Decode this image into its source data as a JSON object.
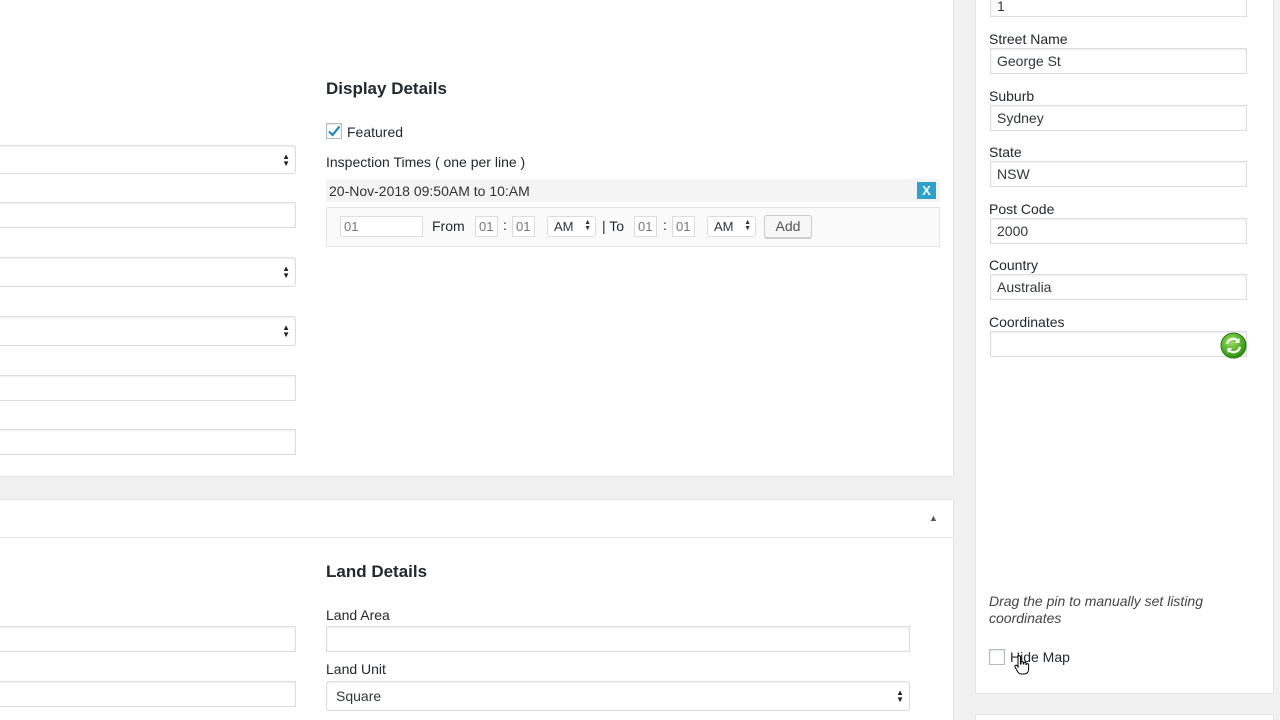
{
  "display_details": {
    "heading": "Display Details",
    "featured_label": "Featured",
    "featured_checked": true,
    "inspection_label": "Inspection Times ( one per line )",
    "inspection_entries": [
      "20-Nov-2018 09:50AM to 10:AM"
    ],
    "remove_label": "X",
    "new_entry": {
      "date_placeholder": "01",
      "from_label": "From",
      "from_hour": "01",
      "from_min": "01",
      "separator": ":",
      "from_ampm": "AM",
      "to_label": "| To",
      "to_hour": "01",
      "to_min": "01",
      "to_ampm": "AM",
      "add_label": "Add"
    }
  },
  "land_details": {
    "heading": "Land Details",
    "land_area_label": "Land Area",
    "land_area_value": "",
    "land_unit_label": "Land Unit",
    "land_unit_value": "Square"
  },
  "address": {
    "street_number_value": "1",
    "street_name_label": "Street Name",
    "street_name_value": "George St",
    "suburb_label": "Suburb",
    "suburb_value": "Sydney",
    "state_label": "State",
    "state_value": "NSW",
    "postcode_label": "Post Code",
    "postcode_value": "2000",
    "country_label": "Country",
    "country_value": "Australia",
    "coordinates_label": "Coordinates",
    "coordinates_value": "",
    "map_note": "Drag the pin to manually set listing coordinates",
    "hide_map_label": "Hide Map",
    "hide_map_checked": false
  },
  "colors": {
    "accent_blue": "#2ea2cc",
    "refresh_green": "#4caf22",
    "checkmark": "#1e8cbe"
  }
}
